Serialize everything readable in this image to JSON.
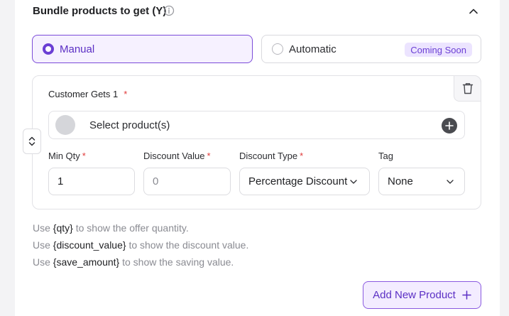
{
  "section": {
    "title": "Bundle products to get (Y)"
  },
  "options": {
    "manual_label": "Manual",
    "automatic_label": "Automatic",
    "coming_soon": "Coming Soon",
    "selected": "Manual"
  },
  "card": {
    "title": "Customer Gets 1",
    "required_mark": "*",
    "product_placeholder": "Select product(s)"
  },
  "fields": {
    "min_qty_label": "Min Qty",
    "min_qty_value": "1",
    "discount_value_label": "Discount Value",
    "discount_value_placeholder": "0",
    "discount_type_label": "Discount Type",
    "discount_type_value": "Percentage Discount",
    "tag_label": "Tag",
    "tag_value": "None"
  },
  "hints": [
    {
      "prefix": "Use ",
      "code": "{qty}",
      "suffix": " to show the offer quantity."
    },
    {
      "prefix": "Use ",
      "code": "{discount_value}",
      "suffix": " to show the discount value."
    },
    {
      "prefix": "Use ",
      "code": "{save_amount}",
      "suffix": " to show the saving value."
    }
  ],
  "actions": {
    "add_new_product": "Add New Product"
  },
  "colors": {
    "accent": "#6b3fd4",
    "required": "#e03a3a"
  }
}
